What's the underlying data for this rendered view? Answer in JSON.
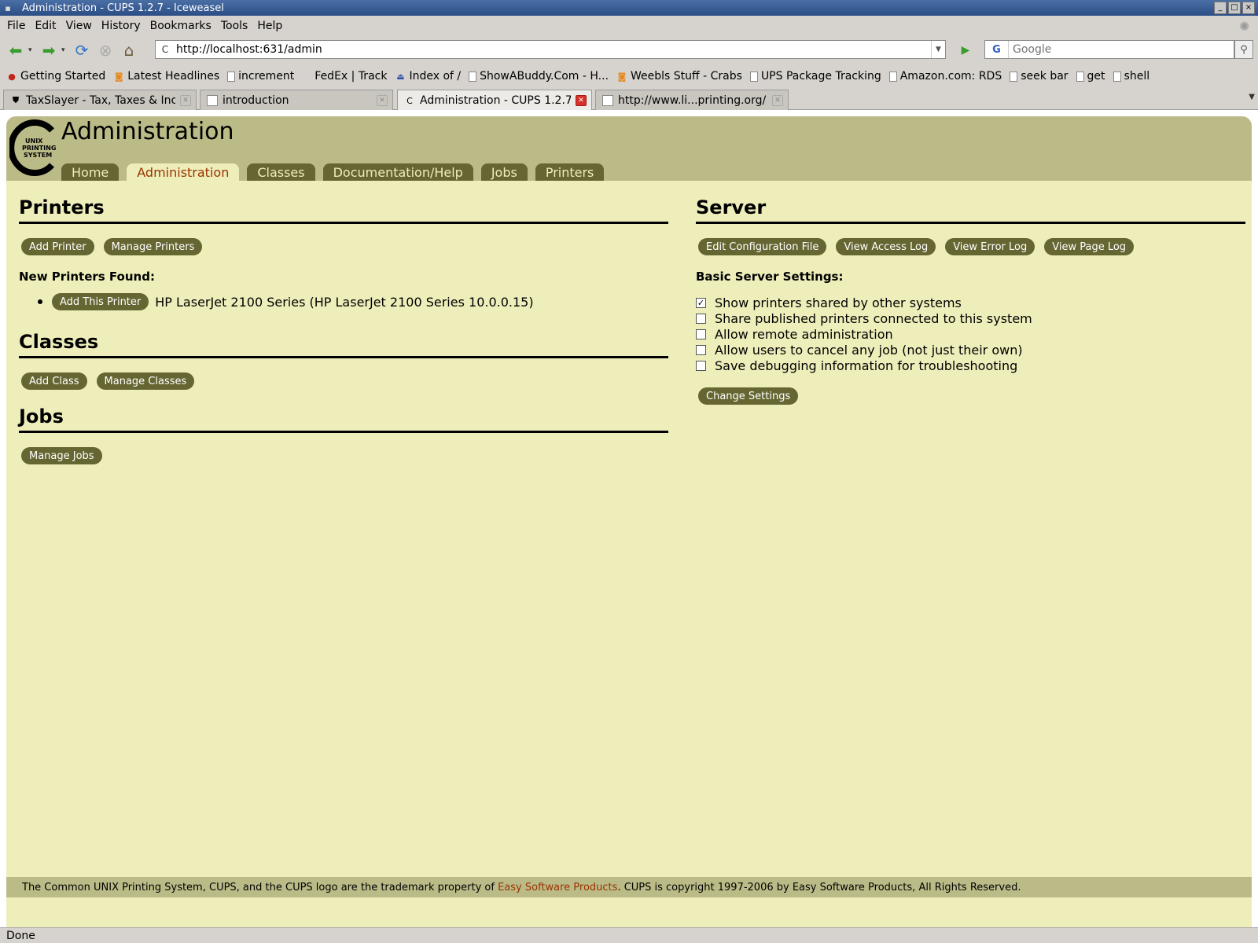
{
  "window": {
    "title": "Administration - CUPS 1.2.7 - Iceweasel",
    "controls": [
      "_",
      "□",
      "×"
    ]
  },
  "menu": [
    "File",
    "Edit",
    "View",
    "History",
    "Bookmarks",
    "Tools",
    "Help"
  ],
  "nav": {
    "url": "http://localhost:631/admin",
    "search_placeholder": "Google"
  },
  "bookmarks": [
    {
      "label": "Getting Started",
      "icon": "red"
    },
    {
      "label": "Latest Headlines",
      "icon": "rss"
    },
    {
      "label": "increment",
      "icon": "page"
    },
    {
      "label": "FedEx | Track",
      "icon": "none"
    },
    {
      "label": "Index of /",
      "icon": "index"
    },
    {
      "label": "ShowABuddy.Com - H...",
      "icon": "page"
    },
    {
      "label": "Weebls Stuff - Crabs",
      "icon": "rss"
    },
    {
      "label": "UPS Package Tracking",
      "icon": "page"
    },
    {
      "label": "Amazon.com: RDS",
      "icon": "page"
    },
    {
      "label": "seek bar",
      "icon": "page"
    },
    {
      "label": "get",
      "icon": "page"
    },
    {
      "label": "shell",
      "icon": "page"
    }
  ],
  "tabs": [
    {
      "label": "TaxSlayer - Tax, Taxes & Inc...",
      "active": false
    },
    {
      "label": "introduction",
      "active": false
    },
    {
      "label": "Administration - CUPS 1.2.7",
      "active": true
    },
    {
      "label": "http://www.li...printing.org/",
      "active": false
    }
  ],
  "cups": {
    "logo_text": [
      "UNIX",
      "PRINTING",
      "SYSTEM"
    ],
    "title": "Administration",
    "navtabs": [
      "Home",
      "Administration",
      "Classes",
      "Documentation/Help",
      "Jobs",
      "Printers"
    ],
    "printers": {
      "heading": "Printers",
      "add_printer": "Add Printer",
      "manage_printers": "Manage Printers",
      "new_found": "New Printers Found:",
      "add_this_printer": "Add This Printer",
      "found_printer": "HP LaserJet 2100 Series (HP LaserJet 2100 Series 10.0.0.15)"
    },
    "classes": {
      "heading": "Classes",
      "add_class": "Add Class",
      "manage_classes": "Manage Classes"
    },
    "jobs": {
      "heading": "Jobs",
      "manage_jobs": "Manage Jobs"
    },
    "server": {
      "heading": "Server",
      "edit_config": "Edit Configuration File",
      "view_access_log": "View Access Log",
      "view_error_log": "View Error Log",
      "view_page_log": "View Page Log",
      "basic_settings": "Basic Server Settings:",
      "settings": [
        {
          "label": "Show printers shared by other systems",
          "checked": true
        },
        {
          "label": "Share published printers connected to this system",
          "checked": false
        },
        {
          "label": "Allow remote administration",
          "checked": false
        },
        {
          "label": "Allow users to cancel any job (not just their own)",
          "checked": false
        },
        {
          "label": "Save debugging information for troubleshooting",
          "checked": false
        }
      ],
      "change_settings": "Change Settings"
    },
    "footer": {
      "pre": "The Common UNIX Printing System, CUPS, and the CUPS logo are the trademark property of ",
      "link": "Easy Software Products",
      "post": ". CUPS is copyright 1997-2006 by Easy Software Products, All Rights Reserved."
    }
  },
  "status": "Done"
}
